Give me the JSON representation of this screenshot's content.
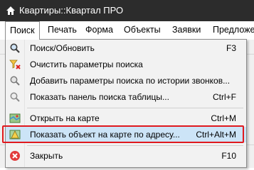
{
  "window": {
    "title": "Квартиры::Квартал ПРО"
  },
  "menubar": {
    "items": [
      {
        "label": "Поиск"
      },
      {
        "label": "Печать"
      },
      {
        "label": "Форма"
      },
      {
        "label": "Объекты"
      },
      {
        "label": "Заявки"
      },
      {
        "label": "Предложен"
      }
    ]
  },
  "menu": {
    "items": [
      {
        "label": "Поиск/Обновить",
        "shortcut": "F3",
        "icon": "magnifier-icon"
      },
      {
        "label": "Очистить параметры поиска",
        "shortcut": "",
        "icon": "clear-filter-icon"
      },
      {
        "label": "Добавить параметры поиска по истории звонков...",
        "shortcut": "",
        "icon": "history-icon"
      },
      {
        "label": "Показать панель поиска таблицы...",
        "shortcut": "Ctrl+F",
        "icon": "search-panel-icon"
      },
      {
        "label": "Открыть на карте",
        "shortcut": "Ctrl+M",
        "icon": "map-icon"
      },
      {
        "label": "Показать объект на карте по адресу...",
        "shortcut": "Ctrl+Alt+M",
        "icon": "map-address-icon"
      },
      {
        "label": "Закрыть",
        "shortcut": "F10",
        "icon": "close-icon"
      }
    ]
  },
  "colors": {
    "titlebar": "#2c2c2c",
    "highlight": "#cce4f7",
    "annotation": "#e0191e"
  }
}
